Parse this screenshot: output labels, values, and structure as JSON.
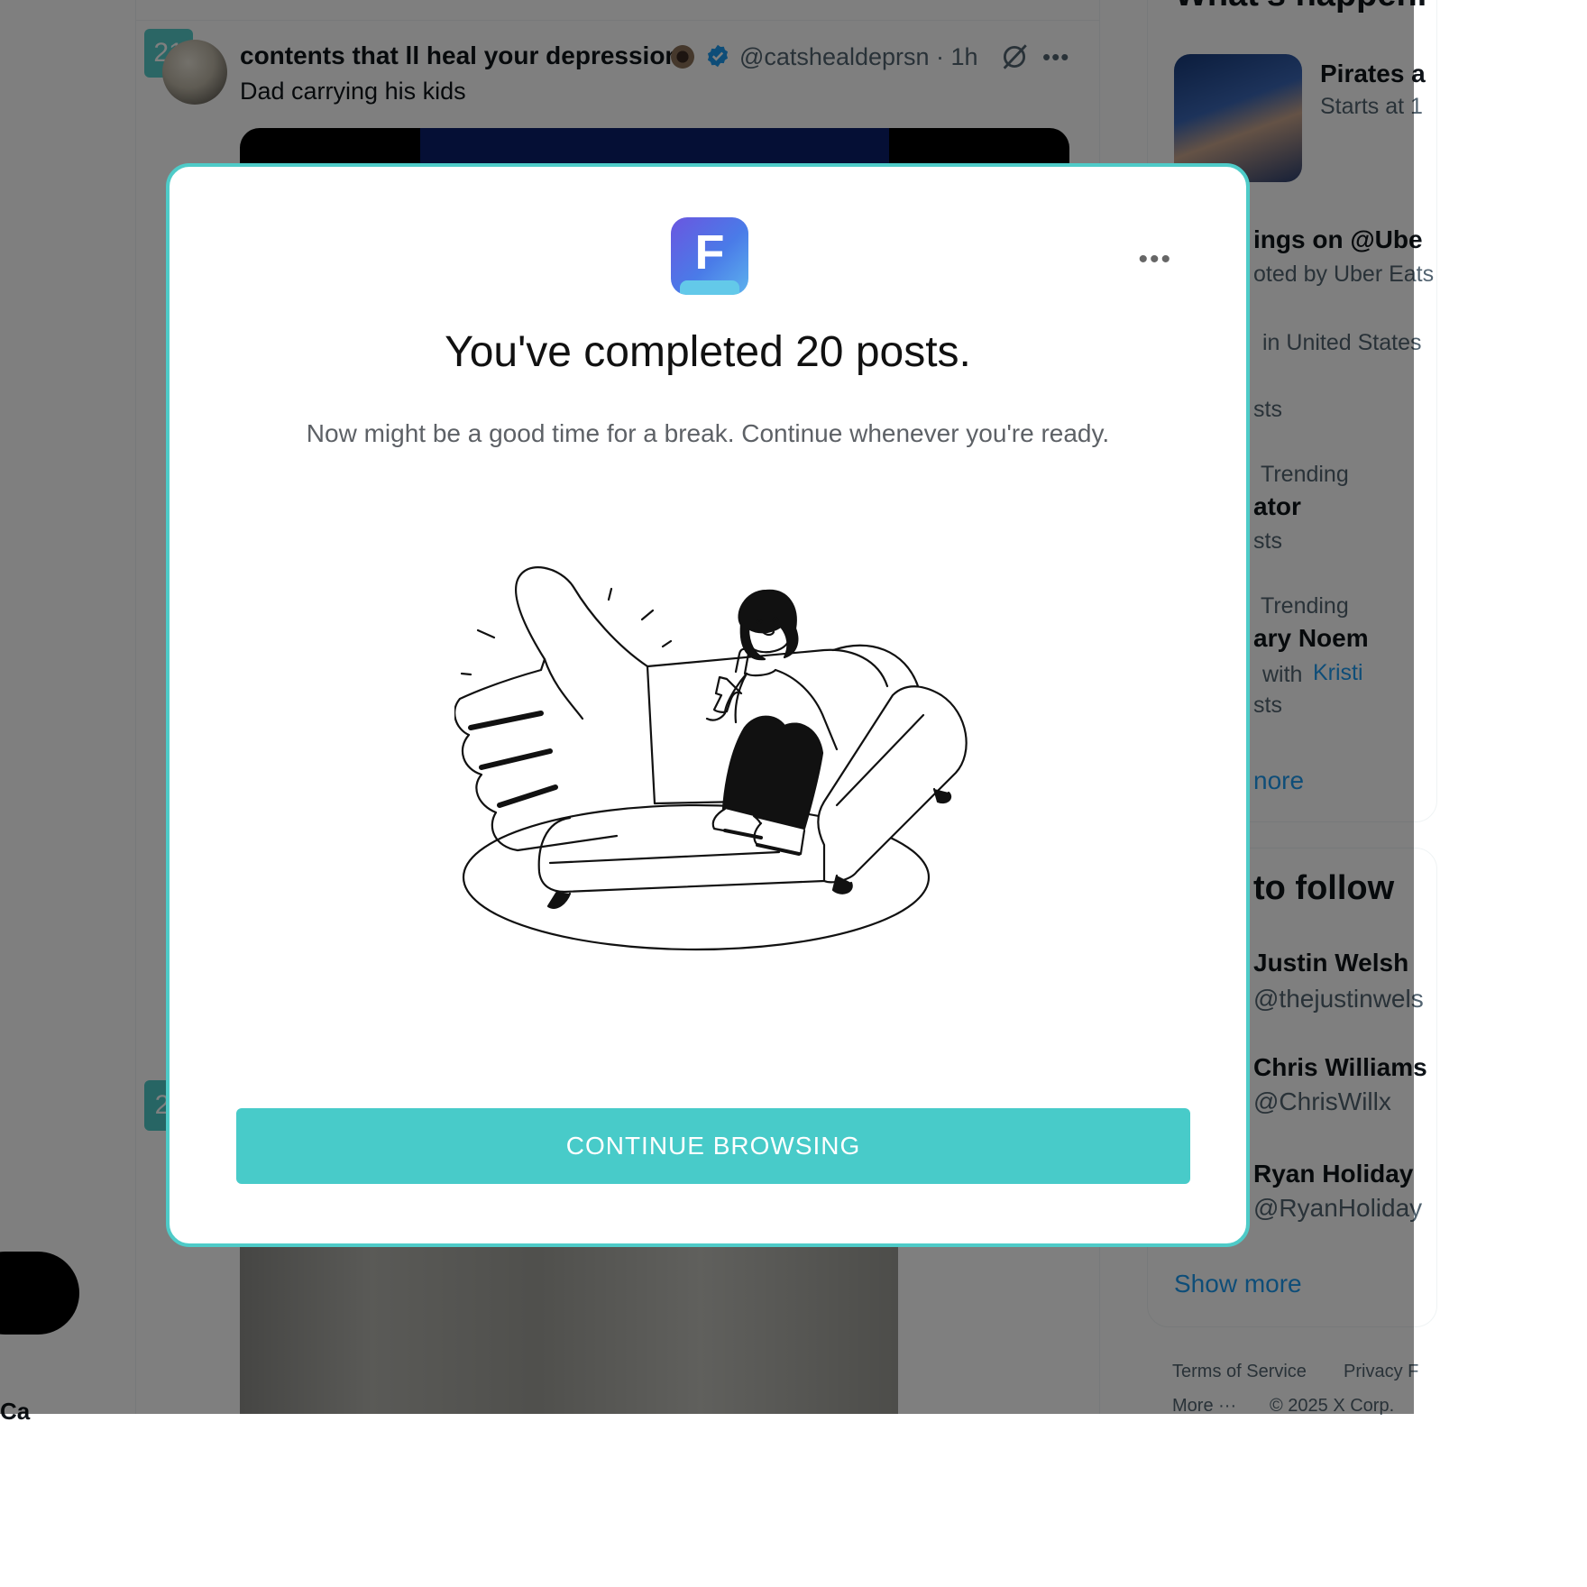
{
  "feed": {
    "post_counter": "21",
    "post_counter_next": "2",
    "post": {
      "author_name": "contents that ll heal your depression",
      "handle_time": "@catshealdeprsn · 1h",
      "text": "Dad carrying his kids"
    },
    "left_partial_text": "Ca"
  },
  "sidebar": {
    "whats_happening_heading": "What's happeni",
    "trend_sports_title": "Pirates a",
    "trend_sports_subtitle": "Starts at 1",
    "promo_title": "ings on @Ube",
    "promo_subtitle": "oted by Uber Eats",
    "trend_location_1": "in United States",
    "trend_posts_1": "sts",
    "trend_context_2": "Trending",
    "trend_name_2": "ator",
    "trend_posts_2": "sts",
    "trend_context_3": "Trending",
    "trend_name_3": "ary Noem",
    "trend_with_3": "with",
    "trend_link_3": "Kristi",
    "trend_posts_3": "sts",
    "trends_show_more": "nore",
    "who_to_follow_heading": "to follow",
    "follow_1_name": "Justin Welsh",
    "follow_1_handle": "@thejustinwels",
    "follow_2_name": "Chris Williams",
    "follow_2_handle": "@ChrisWillx",
    "follow_3_name": "Ryan Holiday",
    "follow_3_handle": "@RyanHoliday",
    "follow_show_more": "Show more",
    "footer_terms": "Terms of Service",
    "footer_privacy": "Privacy F",
    "footer_more": "More ···",
    "footer_copyright": "© 2025 X Corp."
  },
  "modal": {
    "logo_letter": "F",
    "title": "You've completed 20 posts.",
    "subtitle": "Now might be a good time for a break. Continue whenever you're ready.",
    "button_label": "CONTINUE BROWSING",
    "accent_color": "#48cbc9",
    "icons": [
      "app-logo-icon",
      "more-options-icon",
      "break-illustration"
    ]
  }
}
